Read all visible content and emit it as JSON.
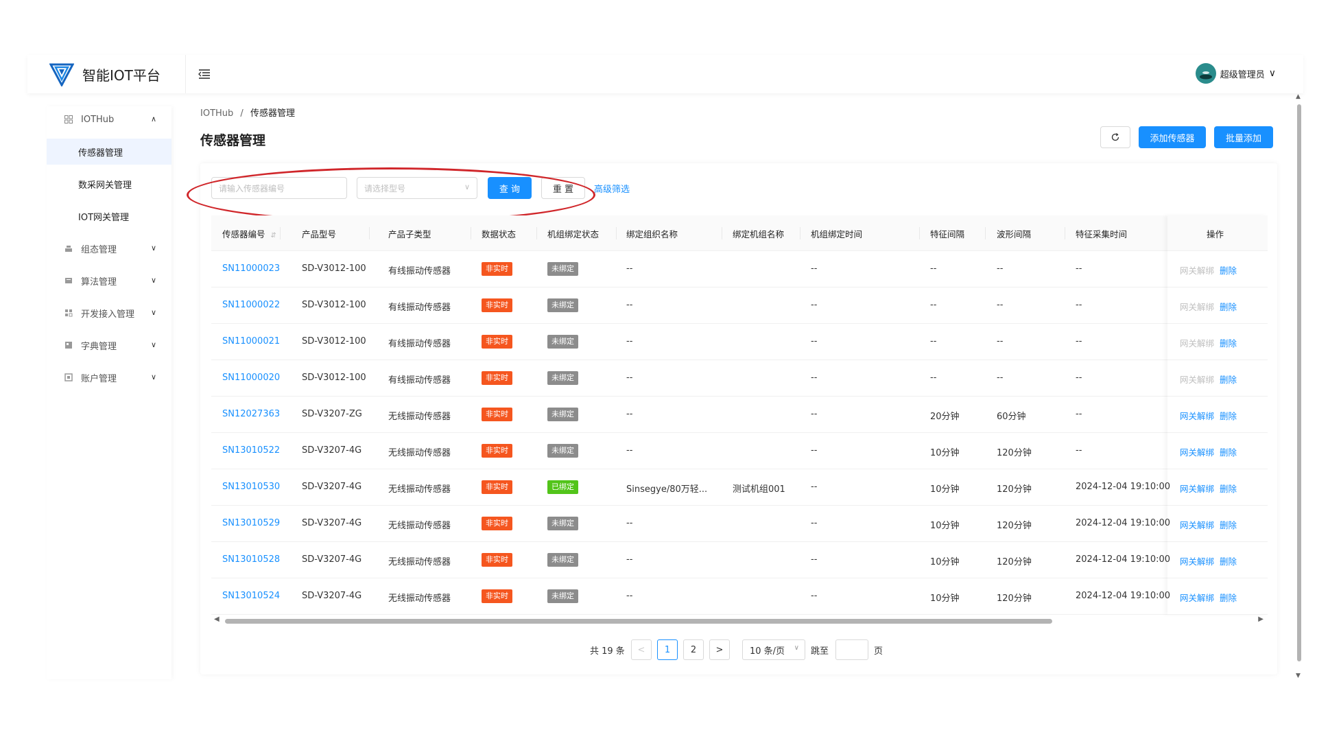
{
  "app": {
    "title": "智能IOT平台",
    "user": "超级管理员",
    "colors": {
      "primary": "#1890ff",
      "danger_tag": "#f5561f",
      "neutral_tag": "#8c8c8c",
      "success_tag": "#52c41a",
      "annotation": "#d0262a"
    }
  },
  "sidebar": {
    "group": {
      "label": "IOTHub",
      "icon": "grid-icon"
    },
    "subitems": [
      {
        "label": "传感器管理",
        "active": true
      },
      {
        "label": "数采网关管理",
        "active": false
      },
      {
        "label": "IOT网关管理",
        "active": false
      }
    ],
    "items": [
      {
        "label": "组态管理",
        "icon": "config-icon"
      },
      {
        "label": "算法管理",
        "icon": "algorithm-icon"
      },
      {
        "label": "开发接入管理",
        "icon": "dev-access-icon"
      },
      {
        "label": "字典管理",
        "icon": "dictionary-icon"
      },
      {
        "label": "账户管理",
        "icon": "account-icon"
      }
    ]
  },
  "breadcrumb": {
    "root": "IOTHub",
    "separator": "/",
    "current": "传感器管理"
  },
  "page": {
    "title": "传感器管理",
    "refresh_icon": "refresh-icon",
    "add_label": "添加传感器",
    "batch_add_label": "批量添加"
  },
  "filters": {
    "sensor_no_placeholder": "请输入传感器编号",
    "model_placeholder": "请选择型号",
    "query_label": "查 询",
    "reset_label": "重 置",
    "advanced_label": "高级筛选"
  },
  "table": {
    "columns": [
      "传感器编号",
      "产品型号",
      "产品子类型",
      "数据状态",
      "机组绑定状态",
      "绑定组织名称",
      "绑定机组名称",
      "机组绑定时间",
      "特征间隔",
      "波形间隔",
      "特征采集时间",
      "操作"
    ],
    "op_unbind": "网关解绑",
    "op_delete": "删除",
    "rows": [
      {
        "sn": "SN11000023",
        "model": "SD-V3012-100",
        "subtype": "有线振动传感器",
        "data_status": "非实时",
        "bind_status": "未绑定",
        "org": "--",
        "unit": "",
        "bind_time": "--",
        "feat_interval": "--",
        "wave_interval": "--",
        "feat_time": "--",
        "unbind_enabled": false
      },
      {
        "sn": "SN11000022",
        "model": "SD-V3012-100",
        "subtype": "有线振动传感器",
        "data_status": "非实时",
        "bind_status": "未绑定",
        "org": "--",
        "unit": "",
        "bind_time": "--",
        "feat_interval": "--",
        "wave_interval": "--",
        "feat_time": "--",
        "unbind_enabled": false
      },
      {
        "sn": "SN11000021",
        "model": "SD-V3012-100",
        "subtype": "有线振动传感器",
        "data_status": "非实时",
        "bind_status": "未绑定",
        "org": "--",
        "unit": "",
        "bind_time": "--",
        "feat_interval": "--",
        "wave_interval": "--",
        "feat_time": "--",
        "unbind_enabled": false
      },
      {
        "sn": "SN11000020",
        "model": "SD-V3012-100",
        "subtype": "有线振动传感器",
        "data_status": "非实时",
        "bind_status": "未绑定",
        "org": "--",
        "unit": "",
        "bind_time": "--",
        "feat_interval": "--",
        "wave_interval": "--",
        "feat_time": "--",
        "unbind_enabled": false
      },
      {
        "sn": "SN12027363",
        "model": "SD-V3207-ZG",
        "subtype": "无线振动传感器",
        "data_status": "非实时",
        "bind_status": "未绑定",
        "org": "--",
        "unit": "",
        "bind_time": "--",
        "feat_interval": "20分钟",
        "wave_interval": "60分钟",
        "feat_time": "--",
        "unbind_enabled": true
      },
      {
        "sn": "SN13010522",
        "model": "SD-V3207-4G",
        "subtype": "无线振动传感器",
        "data_status": "非实时",
        "bind_status": "未绑定",
        "org": "--",
        "unit": "",
        "bind_time": "--",
        "feat_interval": "10分钟",
        "wave_interval": "120分钟",
        "feat_time": "--",
        "unbind_enabled": true
      },
      {
        "sn": "SN13010530",
        "model": "SD-V3207-4G",
        "subtype": "无线振动传感器",
        "data_status": "非实时",
        "bind_status": "已绑定",
        "org": "Sinsegye/80万轻...",
        "unit": "测试机组001",
        "bind_time": "--",
        "feat_interval": "10分钟",
        "wave_interval": "120分钟",
        "feat_time": "2024-12-04 19:10:00",
        "unbind_enabled": true
      },
      {
        "sn": "SN13010529",
        "model": "SD-V3207-4G",
        "subtype": "无线振动传感器",
        "data_status": "非实时",
        "bind_status": "未绑定",
        "org": "--",
        "unit": "",
        "bind_time": "--",
        "feat_interval": "10分钟",
        "wave_interval": "120分钟",
        "feat_time": "2024-12-04 19:10:00",
        "unbind_enabled": true
      },
      {
        "sn": "SN13010528",
        "model": "SD-V3207-4G",
        "subtype": "无线振动传感器",
        "data_status": "非实时",
        "bind_status": "未绑定",
        "org": "--",
        "unit": "",
        "bind_time": "--",
        "feat_interval": "10分钟",
        "wave_interval": "120分钟",
        "feat_time": "2024-12-04 19:10:00",
        "unbind_enabled": true
      },
      {
        "sn": "SN13010524",
        "model": "SD-V3207-4G",
        "subtype": "无线振动传感器",
        "data_status": "非实时",
        "bind_status": "未绑定",
        "org": "--",
        "unit": "",
        "bind_time": "--",
        "feat_interval": "10分钟",
        "wave_interval": "120分钟",
        "feat_time": "2024-12-04 19:10:00",
        "unbind_enabled": true
      }
    ]
  },
  "pagination": {
    "total": "共 19 条",
    "prev": "<",
    "pages": [
      "1",
      "2"
    ],
    "current_page": "1",
    "next": ">",
    "page_size": "10 条/页",
    "jump_label": "跳至",
    "page_suffix": "页"
  }
}
